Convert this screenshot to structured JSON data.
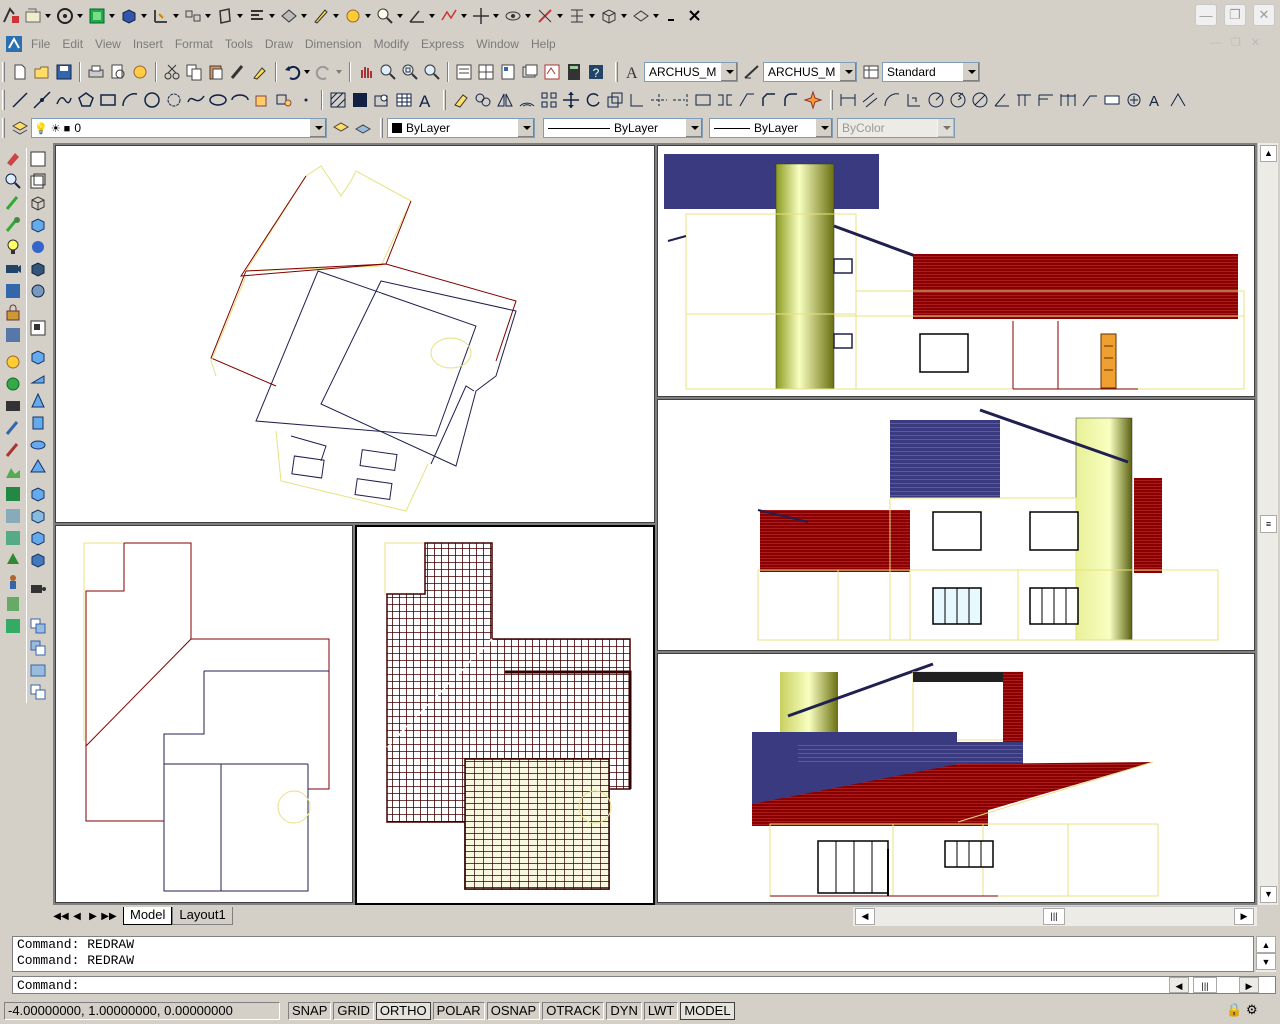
{
  "menu": [
    "File",
    "Edit",
    "View",
    "Insert",
    "Format",
    "Tools",
    "Draw",
    "Dimension",
    "Modify",
    "Express",
    "Window",
    "Help"
  ],
  "styles": {
    "text_style": "ARCHUS_M",
    "dim_style": "ARCHUS_M",
    "table_style": "Standard"
  },
  "layer": {
    "name": "0",
    "color": "ByLayer",
    "linetype": "ByLayer",
    "lineweight": "ByLayer",
    "plotstyle": "ByColor"
  },
  "tabs": [
    "Model",
    "Layout1"
  ],
  "commands": {
    "line1": "Command:  REDRAW",
    "line2": "Command:  REDRAW",
    "prompt": "Command:"
  },
  "status": {
    "coords": "-4.00000000, 1.00000000, 0.00000000",
    "toggles": [
      "SNAP",
      "GRID",
      "ORTHO",
      "POLAR",
      "OSNAP",
      "OTRACK",
      "DYN",
      "LWT",
      "MODEL"
    ]
  },
  "colors": {
    "chrome": "#d4d0c8",
    "viewport": "#ffffff",
    "yellow_line": "#f0f080",
    "dark_red": "#800000",
    "roof_blue": "#3a3a80",
    "column": "#e8f098"
  }
}
